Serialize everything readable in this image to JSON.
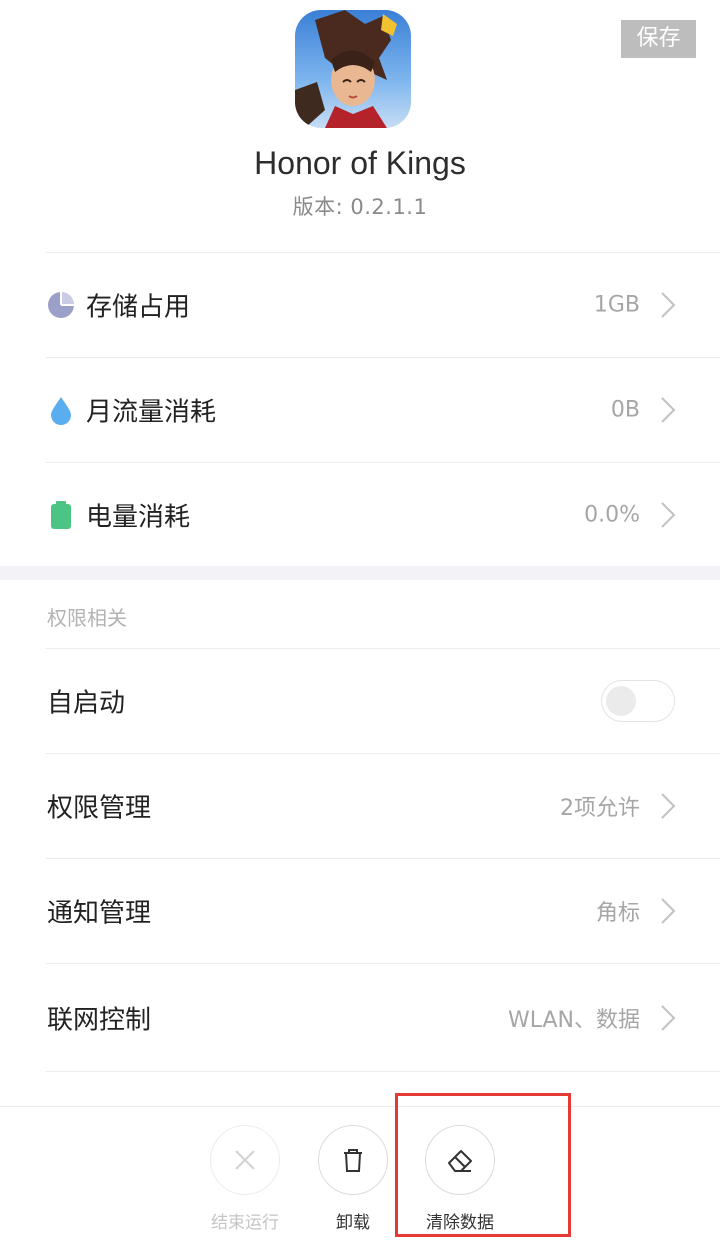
{
  "header": {
    "save_label": "保存"
  },
  "app": {
    "name": "Honor of Kings",
    "version": "版本: 0.2.1.1"
  },
  "usage_rows": [
    {
      "label": "存储占用",
      "value": "1GB",
      "icon": "pie-chart-icon",
      "icon_color": "#9aa0c8"
    },
    {
      "label": "月流量消耗",
      "value": "0B",
      "icon": "water-drop-icon",
      "icon_color": "#5aaef0"
    },
    {
      "label": "电量消耗",
      "value": "0.0%",
      "icon": "battery-icon",
      "icon_color": "#4cc484"
    }
  ],
  "permissions": {
    "section_title": "权限相关",
    "autostart": {
      "label": "自启动",
      "enabled": false
    },
    "rows": [
      {
        "label": "权限管理",
        "value": "2项允许"
      },
      {
        "label": "通知管理",
        "value": "角标"
      },
      {
        "label": "联网控制",
        "value": "WLAN、数据"
      }
    ]
  },
  "bottom_bar": {
    "buttons": [
      {
        "label": "结束运行",
        "icon": "close-icon",
        "enabled": false
      },
      {
        "label": "卸载",
        "icon": "trash-icon",
        "enabled": true
      },
      {
        "label": "清除数据",
        "icon": "eraser-icon",
        "enabled": true
      }
    ]
  },
  "colors": {
    "highlight": "#e53935",
    "save_button_bg": "#bdbdbd"
  }
}
